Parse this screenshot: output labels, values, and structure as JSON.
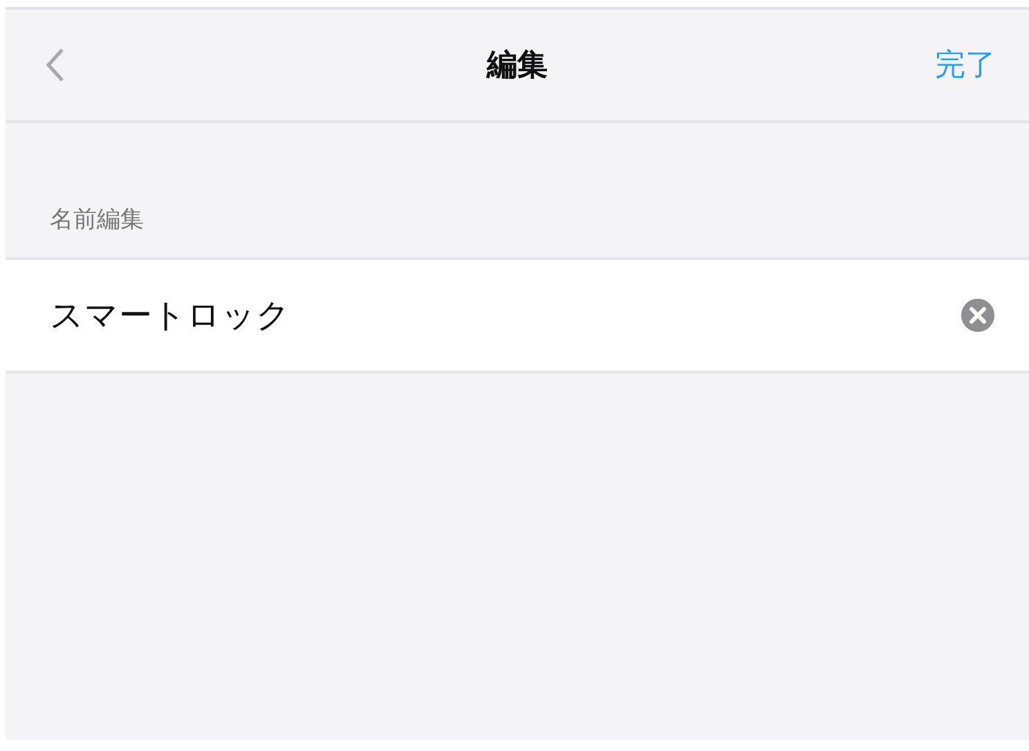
{
  "nav_bar": {
    "title": "編集",
    "done_button": "完了"
  },
  "section": {
    "header": "名前編集"
  },
  "name_field": {
    "value": "スマートロック"
  }
}
